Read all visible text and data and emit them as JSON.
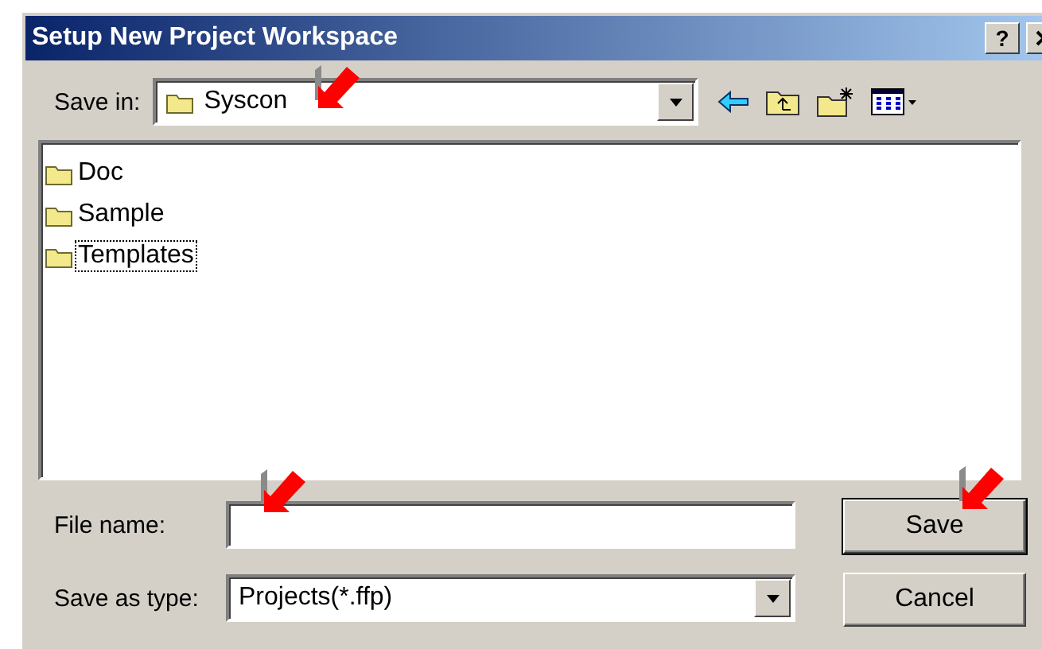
{
  "window": {
    "title": "Setup New Project Workspace",
    "help_button": "?"
  },
  "save_in": {
    "label": "Save in:",
    "value": "Syscon"
  },
  "files": [
    {
      "name": "Doc",
      "selected": false
    },
    {
      "name": "Sample",
      "selected": false
    },
    {
      "name": "Templates",
      "selected": true
    }
  ],
  "file_name": {
    "label": "File name:"
  },
  "save_as_type": {
    "label": "Save as type:",
    "value": "Projects(*.ffp)"
  },
  "buttons": [
    {
      "label": "Save",
      "default": true
    },
    {
      "label": "Cancel",
      "default": false
    }
  ]
}
